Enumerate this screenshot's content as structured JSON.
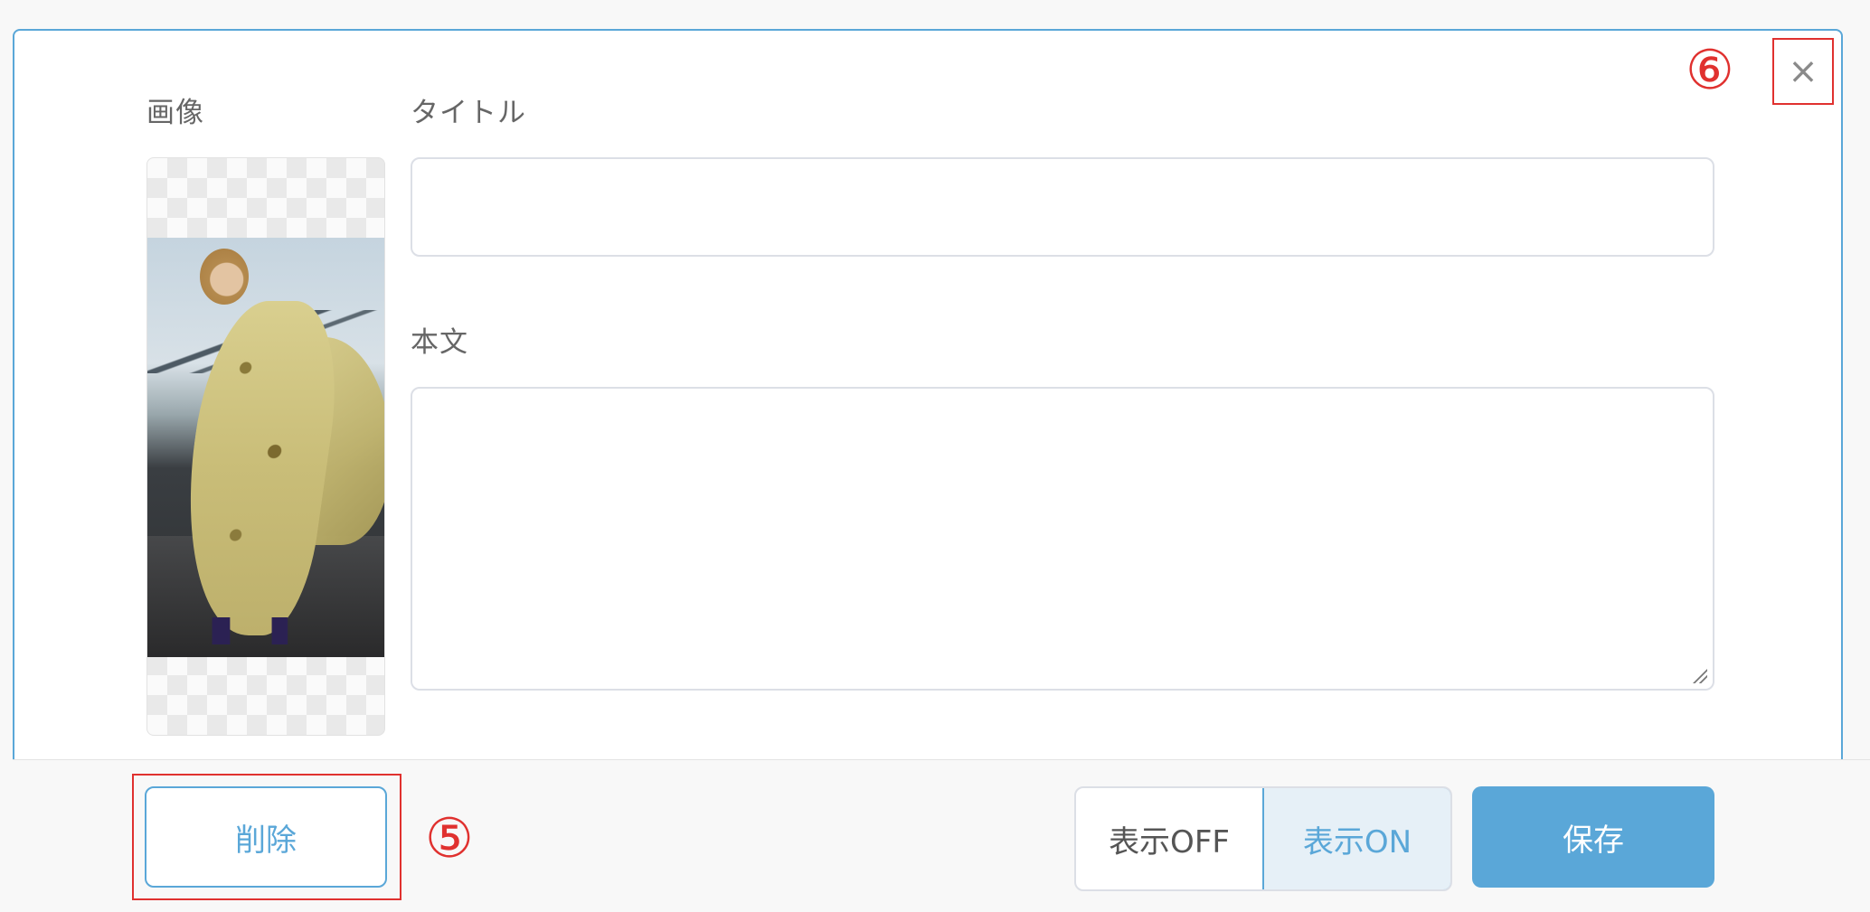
{
  "form": {
    "image_label": "画像",
    "title_label": "タイトル",
    "title_value": "",
    "body_label": "本文",
    "body_value": ""
  },
  "annotations": {
    "close_marker": "⑥",
    "delete_marker": "⑤"
  },
  "header": {
    "close_glyph": "×"
  },
  "footer": {
    "delete_label": "削除",
    "display_off_label": "表示OFF",
    "display_on_label": "表示ON",
    "save_label": "保存",
    "display_state": "on"
  },
  "colors": {
    "accent": "#5aa7d8",
    "annotation": "#e0312f",
    "border": "#dcdfe6"
  },
  "icons": {
    "close": "close-icon",
    "resize": "resize-grip-icon"
  }
}
